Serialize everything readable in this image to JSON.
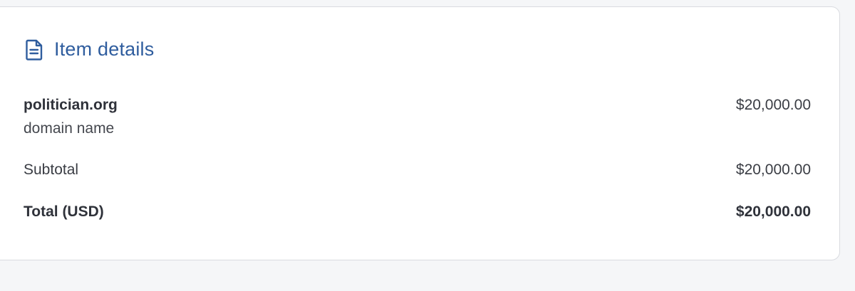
{
  "section": {
    "icon": "document-icon",
    "title": "Item details"
  },
  "item": {
    "name": "politician.org",
    "description": "domain name",
    "price": "$20,000.00"
  },
  "subtotal": {
    "label": "Subtotal",
    "value": "$20,000.00"
  },
  "total": {
    "label": "Total (USD)",
    "value": "$20,000.00"
  },
  "colors": {
    "accent": "#2f5d9e",
    "text": "#3a3d44",
    "background": "#f5f6f8",
    "card": "#ffffff"
  }
}
